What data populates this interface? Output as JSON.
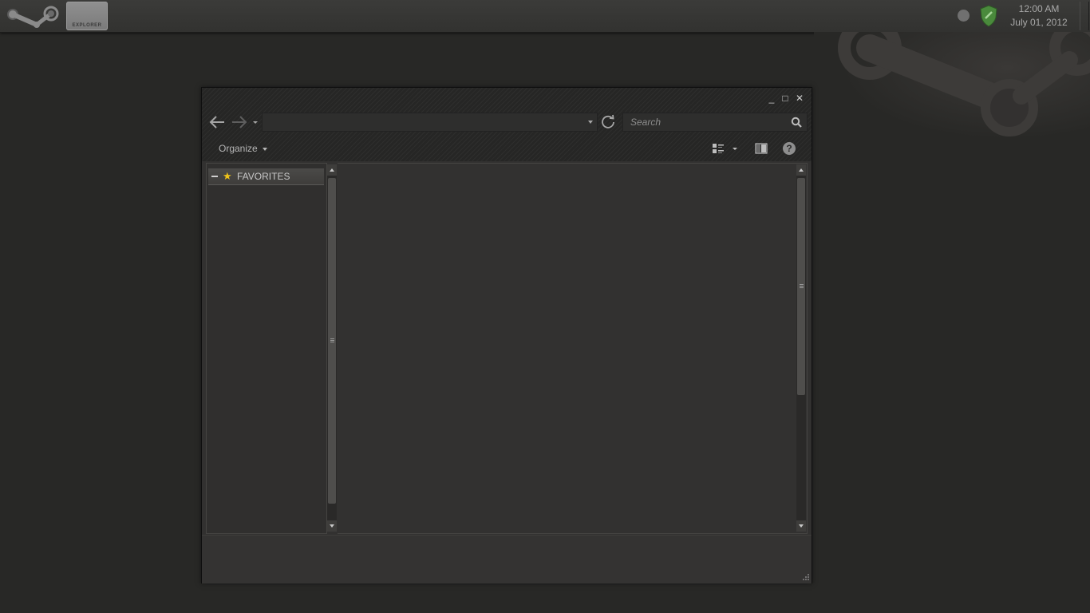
{
  "taskbar": {
    "start_icon": "steam-logo-icon",
    "task_label": "EXPLORER",
    "clock_time": "12:00 AM",
    "clock_date": "July 01, 2012"
  },
  "window": {
    "controls": {
      "minimize": "_",
      "maximize": "□",
      "close": "✕"
    },
    "search_placeholder": "Search",
    "organize_label": "Organize",
    "help_label": "?",
    "favorites_label": "FAVORITES"
  },
  "colors": {
    "desktop": "#282826",
    "taskbar": "#363634",
    "window": "#323130",
    "accent_star": "#f0c419",
    "shield": "#4a8a3c"
  }
}
